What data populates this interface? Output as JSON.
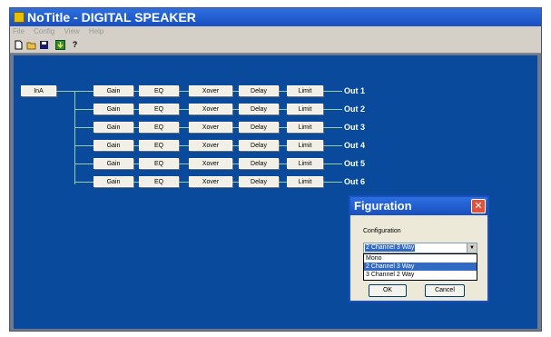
{
  "window": {
    "title": "NoTitle - DIGITAL SPEAKER"
  },
  "menu": [
    "File",
    "Config",
    "View",
    "Help"
  ],
  "toolbar": {
    "icons": [
      "new-document-icon",
      "open-folder-icon",
      "save-icon",
      "download-icon",
      "help-icon"
    ],
    "help_glyph": "?"
  },
  "canvas": {
    "input_label": "InA",
    "module_labels": [
      "Gain",
      "EQ",
      "Xover",
      "Delay",
      "Limit"
    ],
    "outputs": [
      "Out 1",
      "Out 2",
      "Out 3",
      "Out 4",
      "Out 5",
      "Out 6"
    ]
  },
  "dialog": {
    "title": "Figuration",
    "close_glyph": "✕",
    "field_label": "Configuration",
    "selected_value": "2 Channel 3 Way",
    "arrow_glyph": "▼",
    "options": [
      "Mono",
      "2 Channel 3 Way",
      "3 Channel 2 Way"
    ],
    "highlighted_option": "2 Channel 3 Way",
    "ok_label": "OK",
    "cancel_label": "Cancel"
  },
  "colors": {
    "canvas_bg": "#0a4a9c",
    "title_bar": "#1a4fbf",
    "connector": "#9ad0a0",
    "selection": "#316ac5"
  }
}
